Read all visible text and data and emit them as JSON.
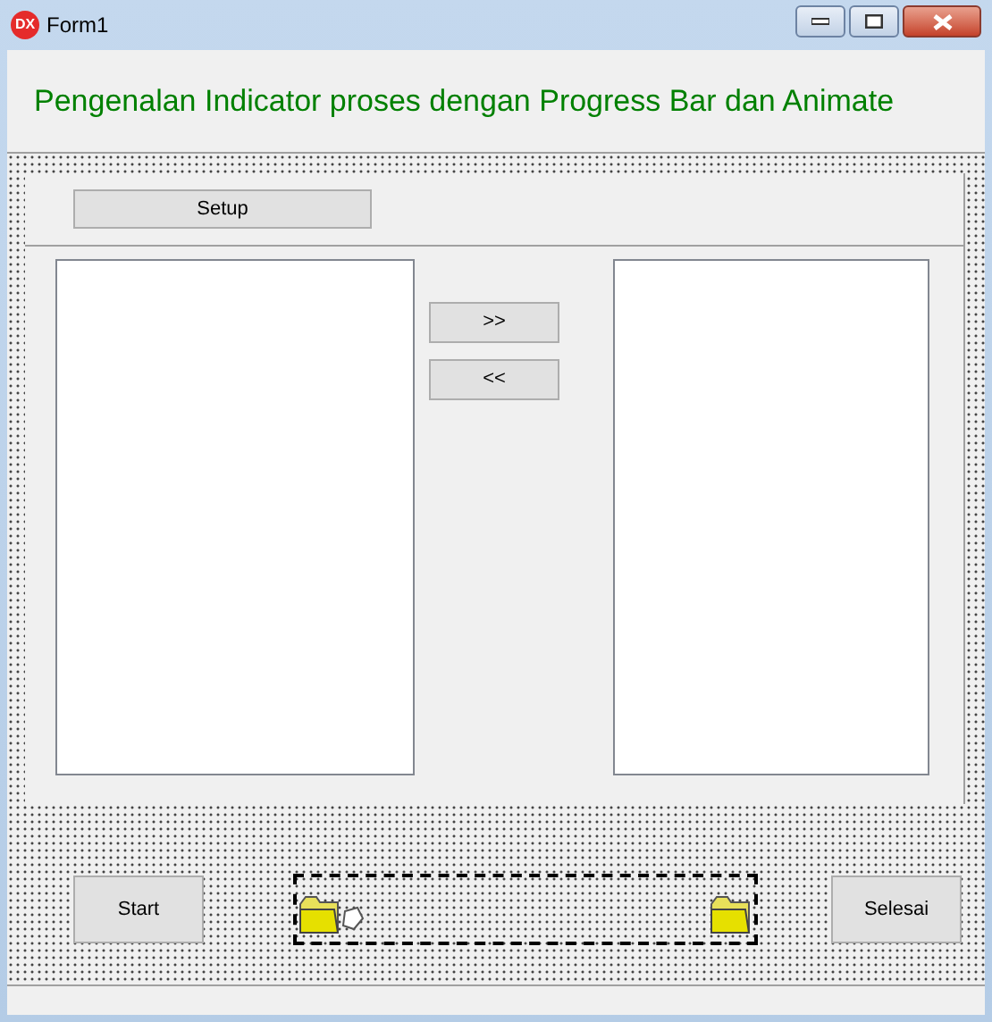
{
  "window": {
    "title": "Form1",
    "app_icon": "DX"
  },
  "header": {
    "title": "Pengenalan Indicator proses dengan Progress Bar dan Animate"
  },
  "setup_button": "Setup",
  "move_buttons": [
    ">>",
    "<<"
  ],
  "bottom": {
    "start_button": "Start",
    "finish_button": "Selesai"
  }
}
